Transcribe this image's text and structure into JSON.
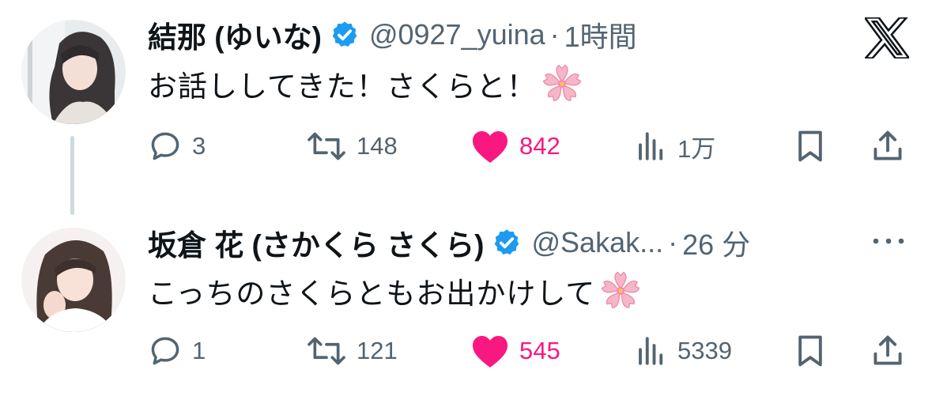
{
  "tweets": [
    {
      "author_name": "結那 (ゆいな)",
      "handle": "@0927_yuina",
      "separator": "·",
      "time": "1時間",
      "text": "お話ししてきた！さくらと！",
      "emoji": "cherry-blossom",
      "replies": "3",
      "retweets": "148",
      "likes": "842",
      "views": "1万",
      "liked": true
    },
    {
      "author_name": "坂倉 花 (さかくら さくら)",
      "handle": "@Sakak...",
      "separator": "·",
      "time": "26 分",
      "text": "こっちのさくらともお出かけして",
      "emoji": "cherry-blossom",
      "replies": "1",
      "retweets": "121",
      "likes": "545",
      "views": "5339",
      "liked": true
    }
  ],
  "icons": {
    "logo": "x-logo-icon",
    "verified": "verified-badge-icon",
    "reply": "reply-icon",
    "retweet": "retweet-icon",
    "like": "heart-icon",
    "views": "views-icon",
    "bookmark": "bookmark-icon",
    "share": "share-icon",
    "more": "more-icon"
  },
  "colors": {
    "text": "#0f1419",
    "secondary": "#536471",
    "like": "#f91880",
    "verified": "#1d9bf0",
    "thread_line": "#cfd9de"
  }
}
